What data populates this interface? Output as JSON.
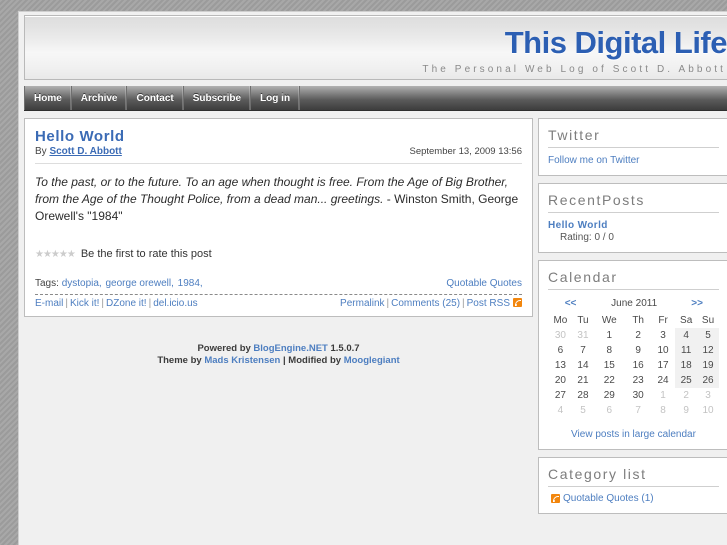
{
  "header": {
    "title": "This Digital Life",
    "subtitle": "The Personal Web Log of Scott D. Abbott"
  },
  "nav": {
    "items": [
      {
        "label": "Home"
      },
      {
        "label": "Archive"
      },
      {
        "label": "Contact"
      },
      {
        "label": "Subscribe"
      },
      {
        "label": "Log in"
      }
    ]
  },
  "post": {
    "title": "Hello World",
    "by_prefix": "By ",
    "author": "Scott D. Abbott",
    "date": "September 13, 2009 13:56",
    "body_italic": "To the past, or to the future. To an age when thought is free. From the Age of Big Brother, from the Age of the Thought Police, from a dead man... greetings.",
    "body_plain": " - Winston Smith, George Orewell's \"1984\"",
    "stars": "★★★★★",
    "rate_text": "Be the first to rate this post",
    "tags_label": "Tags:",
    "tags": [
      {
        "label": "dystopia,"
      },
      {
        "label": "george orewell,"
      },
      {
        "label": "1984,"
      }
    ],
    "category": "Quotable Quotes",
    "share_links": [
      {
        "label": "E-mail"
      },
      {
        "label": "Kick it!"
      },
      {
        "label": "DZone it!"
      },
      {
        "label": "del.icio.us"
      }
    ],
    "action_links": [
      {
        "label": "Permalink"
      },
      {
        "label": "Comments (25)"
      },
      {
        "label": "Post RSS"
      }
    ],
    "rss_icon": "rss-icon"
  },
  "footer": {
    "powered_prefix": "Powered by ",
    "engine": "BlogEngine.NET",
    "version": " 1.5.0.7",
    "theme_prefix": "Theme by ",
    "theme_author": "Mads Kristensen",
    "modified_prefix": " | Modified by ",
    "modifier": "Mooglegiant"
  },
  "sidebar": {
    "twitter": {
      "title": "Twitter",
      "link": "Follow me on Twitter"
    },
    "recent_posts": {
      "title": "RecentPosts",
      "items": [
        {
          "title": "Hello World",
          "rating": "Rating: 0 / 0"
        }
      ]
    },
    "calendar": {
      "title": "Calendar",
      "prev": "<<",
      "month": "June 2011",
      "next": ">>",
      "daynames": [
        "Mo",
        "Tu",
        "We",
        "Th",
        "Fr",
        "Sa",
        "Su"
      ],
      "weeks": [
        [
          {
            "d": "30",
            "other": true
          },
          {
            "d": "31",
            "other": true
          },
          {
            "d": "1"
          },
          {
            "d": "2"
          },
          {
            "d": "3"
          },
          {
            "d": "4",
            "hi": true
          },
          {
            "d": "5",
            "hi": true
          }
        ],
        [
          {
            "d": "6"
          },
          {
            "d": "7"
          },
          {
            "d": "8"
          },
          {
            "d": "9"
          },
          {
            "d": "10"
          },
          {
            "d": "11",
            "hi": true
          },
          {
            "d": "12",
            "hi": true
          }
        ],
        [
          {
            "d": "13"
          },
          {
            "d": "14"
          },
          {
            "d": "15"
          },
          {
            "d": "16"
          },
          {
            "d": "17"
          },
          {
            "d": "18",
            "hi": true
          },
          {
            "d": "19",
            "hi": true
          }
        ],
        [
          {
            "d": "20"
          },
          {
            "d": "21"
          },
          {
            "d": "22"
          },
          {
            "d": "23"
          },
          {
            "d": "24"
          },
          {
            "d": "25",
            "hi": true
          },
          {
            "d": "26",
            "hi": true
          }
        ],
        [
          {
            "d": "27"
          },
          {
            "d": "28"
          },
          {
            "d": "29"
          },
          {
            "d": "30"
          },
          {
            "d": "1",
            "other": true
          },
          {
            "d": "2",
            "other": true
          },
          {
            "d": "3",
            "other": true
          }
        ],
        [
          {
            "d": "4",
            "other": true
          },
          {
            "d": "5",
            "other": true
          },
          {
            "d": "6",
            "other": true
          },
          {
            "d": "7",
            "other": true
          },
          {
            "d": "8",
            "other": true
          },
          {
            "d": "9",
            "other": true
          },
          {
            "d": "10",
            "other": true
          }
        ]
      ],
      "large_link": "View posts in large calendar"
    },
    "category_list": {
      "title": "Category list",
      "items": [
        {
          "label": "Quotable Quotes (1)",
          "icon": "rss-icon"
        }
      ]
    }
  }
}
